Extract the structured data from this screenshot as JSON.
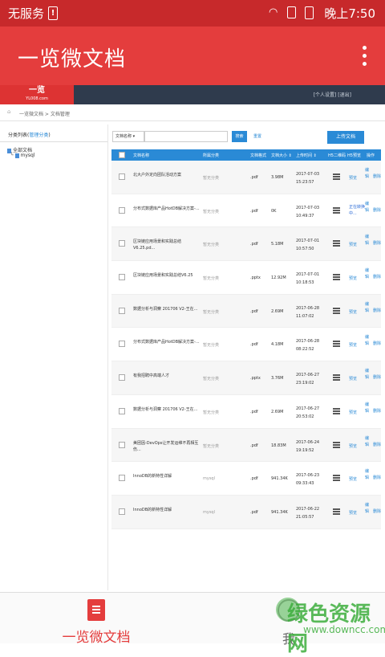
{
  "status": {
    "carrier": "无服务",
    "time": "晚上7:50",
    "battery_warn": "!"
  },
  "appbar": {
    "title": "一览微文档"
  },
  "site": {
    "logo_main": "一览",
    "logo_sub": "YL008.com",
    "links": "[个人设置] [退出]"
  },
  "breadcrumb": "一览微文档 > 文档管理",
  "sidebar": {
    "heading": "分类列表(",
    "heading_link": "管理分类",
    "heading_end": ")",
    "root": "全部文档",
    "child": "mysql"
  },
  "toolbar": {
    "select_value": "文档名称",
    "search_label": "搜索",
    "reset_label": "重置",
    "upload_label": "上传文档"
  },
  "table": {
    "headers": [
      "文档名称",
      "所属分类",
      "文档格式",
      "文档大小 ⇕",
      "上传时间 ⇕",
      "H5二维码",
      "H5预览",
      "操作"
    ],
    "rows": [
      {
        "name": "北大户外定向团队活动方案",
        "cat": "暂无分类",
        "fmt": ".pdf",
        "size": "3.98M",
        "date": "2017-07-03",
        "time": "15:23:57",
        "preview": "预览",
        "ops": "编辑",
        "del": "删除"
      },
      {
        "name": "分布式数据库产品HotDB解决方案-...",
        "cat": "暂无分类",
        "fmt": ".pdf",
        "size": "0K",
        "date": "2017-07-03",
        "time": "10:49:37",
        "preview": "正在转换中...",
        "ops": "编辑",
        "del": "删除"
      },
      {
        "name": "区块链应用场景和实践总结V6.25.pd...",
        "cat": "暂无分类",
        "fmt": ".pdf",
        "size": "5.18M",
        "date": "2017-07-01",
        "time": "10:57:50",
        "preview": "预览",
        "ops": "编辑",
        "del": "删除"
      },
      {
        "name": "区块链应用场景和实践总结V6.25",
        "cat": "暂无分类",
        "fmt": ".pptx",
        "size": "12.92M",
        "date": "2017-07-01",
        "time": "10:18:53",
        "preview": "预览",
        "ops": "编辑",
        "del": "删除"
      },
      {
        "name": "数据分析与洞察 201706 V2-王在...",
        "cat": "暂无分类",
        "fmt": ".pdf",
        "size": "2.69M",
        "date": "2017-06-28",
        "time": "11:07:02",
        "preview": "预览",
        "ops": "编辑",
        "del": "删除"
      },
      {
        "name": "分布式数据库产品HotDB解决方案-...",
        "cat": "暂无分类",
        "fmt": ".pdf",
        "size": "4.18M",
        "date": "2017-06-28",
        "time": "08:22:52",
        "preview": "预览",
        "ops": "编辑",
        "del": "删除"
      },
      {
        "name": "有我招聘中高端人才",
        "cat": "暂无分类",
        "fmt": ".pptx",
        "size": "3.76M",
        "date": "2017-06-27",
        "time": "23:19:02",
        "preview": "预览",
        "ops": "编辑",
        "del": "删除"
      },
      {
        "name": "数据分析与洞察 201706 V2-王在...",
        "cat": "暂无分类",
        "fmt": ".pdf",
        "size": "2.69M",
        "date": "2017-06-27",
        "time": "20:53:02",
        "preview": "预览",
        "ops": "编辑",
        "del": "删除"
      },
      {
        "name": "美团因-DevOps让开发运维不再相互伤...",
        "cat": "暂无分类",
        "fmt": ".pdf",
        "size": "18.83M",
        "date": "2017-06-24",
        "time": "19:19:52",
        "preview": "预览",
        "ops": "编辑",
        "del": "删除"
      },
      {
        "name": "InnoDB的新特性详解",
        "cat": "mysql",
        "fmt": ".pdf",
        "size": "941.34K",
        "date": "2017-06-23",
        "time": "09:33:43",
        "preview": "预览",
        "ops": "编辑",
        "del": "删除"
      },
      {
        "name": "InnoDB的新特性详解",
        "cat": "mysql",
        "fmt": ".pdf",
        "size": "941.34K",
        "date": "2017-06-22",
        "time": "21:05:57",
        "preview": "预览",
        "ops": "编辑",
        "del": "删除"
      }
    ]
  },
  "bottomnav": {
    "doc_label": "一览微文档",
    "me_label": "我"
  },
  "watermark": {
    "main": "绿色资源网",
    "sub": "www.downcc.com"
  },
  "colors": {
    "red": "#e43d3d",
    "blue": "#2a8ad6",
    "navy": "#2f3b4d"
  }
}
